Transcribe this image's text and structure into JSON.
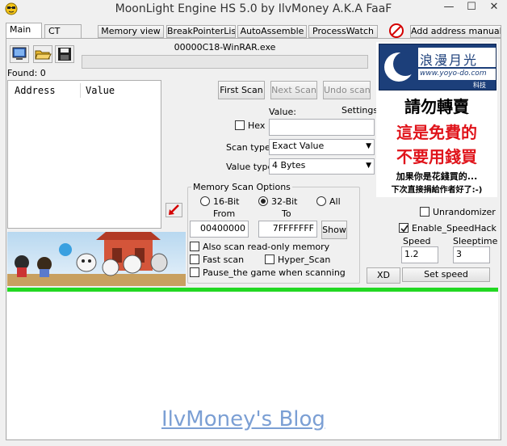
{
  "window": {
    "title": "MoonLight Engine HS 5.0 by IlvMoney A.K.A FaaF"
  },
  "tabs": [
    {
      "label": "Main"
    },
    {
      "label": "CT"
    }
  ],
  "toolbar": {
    "memory_view": "Memory view",
    "breakpoint_list": "BreakPointerList",
    "auto_assemble": "AutoAssemble",
    "process_watch": "ProcessWatch",
    "add_address": "Add address manually"
  },
  "process": {
    "name": "00000C18-WinRAR.exe",
    "progress": 0
  },
  "found": "Found: 0",
  "address_list": {
    "col_address": "Address",
    "col_value": "Value"
  },
  "scan_buttons": {
    "first": "First Scan",
    "next": "Next Scan",
    "undo": "Undo scan"
  },
  "value_section": {
    "value_label": "Value:",
    "settings_label": "Settings",
    "hex_label": "Hex",
    "value": ""
  },
  "scan_type": {
    "label": "Scan type",
    "selected": "Exact Value"
  },
  "value_type": {
    "label": "Value type",
    "selected": "4 Bytes"
  },
  "memory_options": {
    "legend": "Memory Scan Options",
    "r16": "16-Bit",
    "r32": "32-Bit",
    "rall": "All",
    "from_label": "From",
    "to_label": "To",
    "from_value": "00400000",
    "to_value": "7FFFFFFF",
    "show": "Show",
    "readonly": "Also scan read-only memory",
    "fastscan": "Fast scan",
    "hyperscan": "Hyper_Scan",
    "pause": "Pause_the game when scanning"
  },
  "ad": {
    "logo_text": "浪漫月光",
    "logo_url": "www.yoyo-do.com",
    "logo_sub": "科技",
    "line1": "請勿轉賣",
    "line2": "這是免費的",
    "line3": "不要用錢買",
    "line4": "加果你是花錢買的...",
    "line5": "下次直接捐給作者好了:-)"
  },
  "speedhack": {
    "unrandomizer": "Unrandomizer",
    "enable": "Enable_SpeedHack",
    "speed_label": "Speed",
    "sleeptime_label": "Sleeptime",
    "speed_value": "1.2",
    "sleeptime_value": "3",
    "xd": "XD",
    "set_speed": "Set speed"
  },
  "blog": {
    "link": "IlvMoney's Blog"
  },
  "colors": {
    "progress_green": "#22d822",
    "ad_red": "#e0141b",
    "logo_blue": "#1c3f7a",
    "link_blue": "#7b9fd4"
  }
}
